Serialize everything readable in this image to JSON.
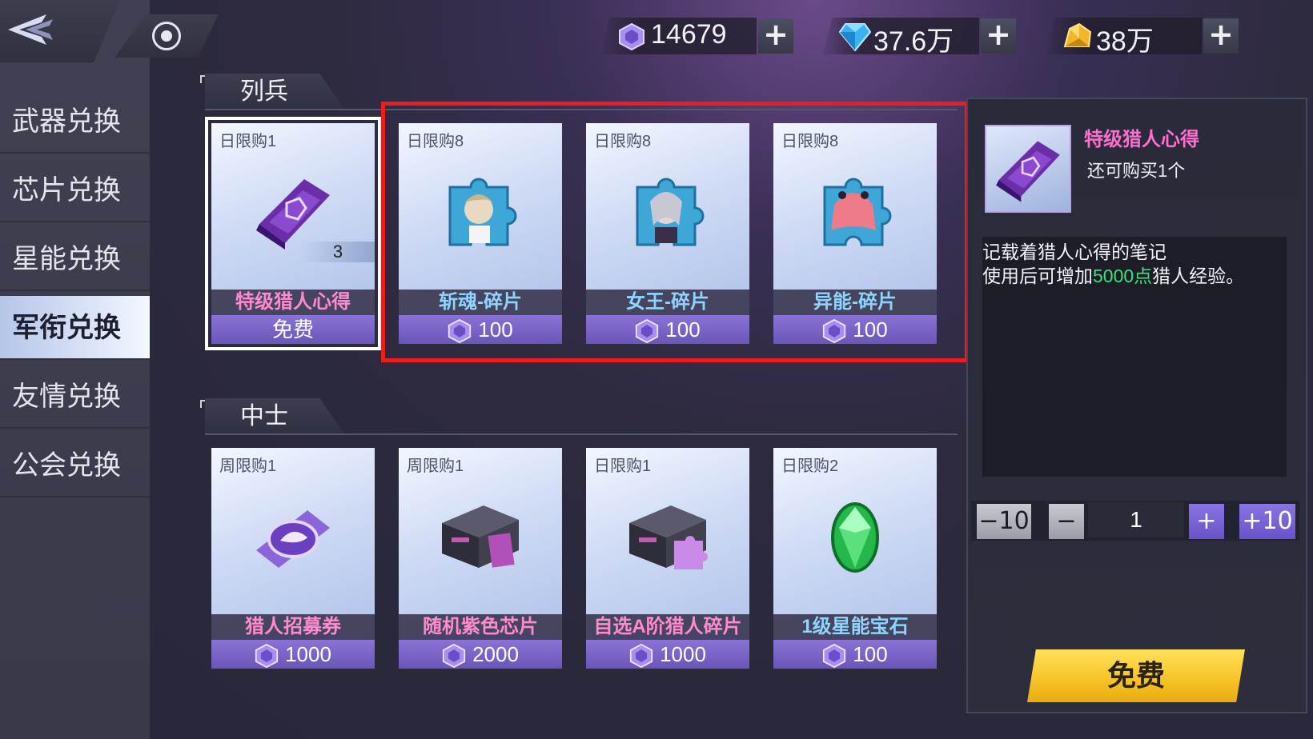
{
  "header": {
    "currencies": [
      {
        "icon": "purple-gem-icon",
        "value": "14679"
      },
      {
        "icon": "blue-diamond-icon",
        "value": "37.6万"
      },
      {
        "icon": "gold-crystal-icon",
        "value": "38万"
      }
    ],
    "plus_symbol": "+"
  },
  "sidebar": {
    "items": [
      {
        "label": "武器兑换"
      },
      {
        "label": "芯片兑换"
      },
      {
        "label": "星能兑换"
      },
      {
        "label": "军衔兑换",
        "active": true
      },
      {
        "label": "友情兑换"
      },
      {
        "label": "公会兑换"
      }
    ]
  },
  "sections": [
    {
      "title": "列兵",
      "items": [
        {
          "limit": "日限购1",
          "name": "特级猎人心得",
          "price": "免费",
          "qty": "3",
          "selected": true,
          "name_color": "#ff8ad0"
        },
        {
          "limit": "日限购8",
          "name": "斩魂-碎片",
          "price": "100",
          "name_color": "#8fd4ff"
        },
        {
          "limit": "日限购8",
          "name": "女王-碎片",
          "price": "100",
          "name_color": "#8fd4ff"
        },
        {
          "limit": "日限购8",
          "name": "异能-碎片",
          "price": "100",
          "name_color": "#8fd4ff"
        }
      ]
    },
    {
      "title": "中士",
      "items": [
        {
          "limit": "周限购1",
          "name": "猎人招募券",
          "price": "1000",
          "name_color": "#ff8ad0"
        },
        {
          "limit": "周限购1",
          "name": "随机紫色芯片",
          "price": "2000",
          "name_color": "#ff8ad0"
        },
        {
          "limit": "日限购1",
          "name": "自选A阶猎人碎片",
          "price": "1000",
          "name_color": "#ff8ad0"
        },
        {
          "limit": "日限购2",
          "name": "1级星能宝石",
          "price": "100",
          "name_color": "#8fd4ff"
        }
      ]
    }
  ],
  "detail": {
    "name": "特级猎人心得",
    "remaining": "还可购买1个",
    "desc_line1": "记载着猎人心得的笔记",
    "desc_line2_pre": "使用后可增加",
    "desc_line2_highlight": "5000点",
    "desc_line2_post": "猎人经验。",
    "highlight_color": "#3fe07a"
  },
  "stepper": {
    "minus10": "−10",
    "minus": "−",
    "count": "1",
    "plus": "+",
    "plus10": "+10"
  },
  "action": {
    "button_label": "免费"
  }
}
